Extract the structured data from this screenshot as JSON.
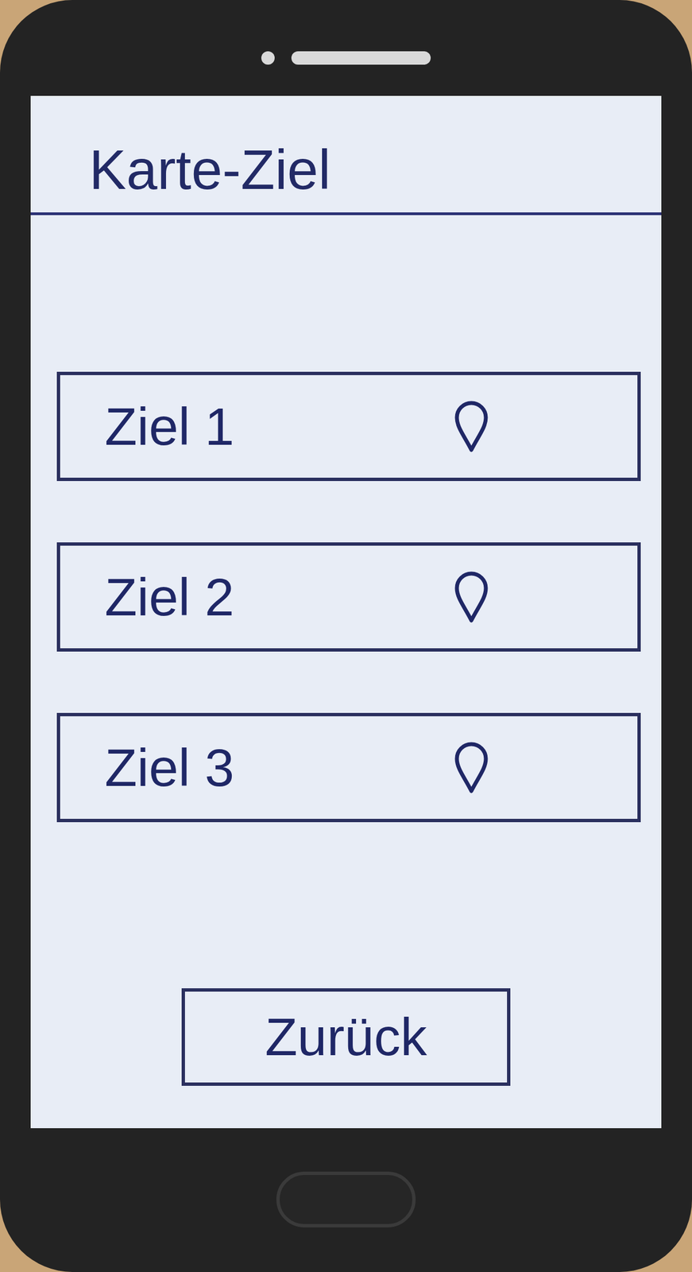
{
  "screen": {
    "title": "Karte-Ziel"
  },
  "destinations": [
    {
      "label": "Ziel 1"
    },
    {
      "label": "Ziel 2"
    },
    {
      "label": "Ziel 3"
    }
  ],
  "buttons": [
    "Zurück"
  ]
}
